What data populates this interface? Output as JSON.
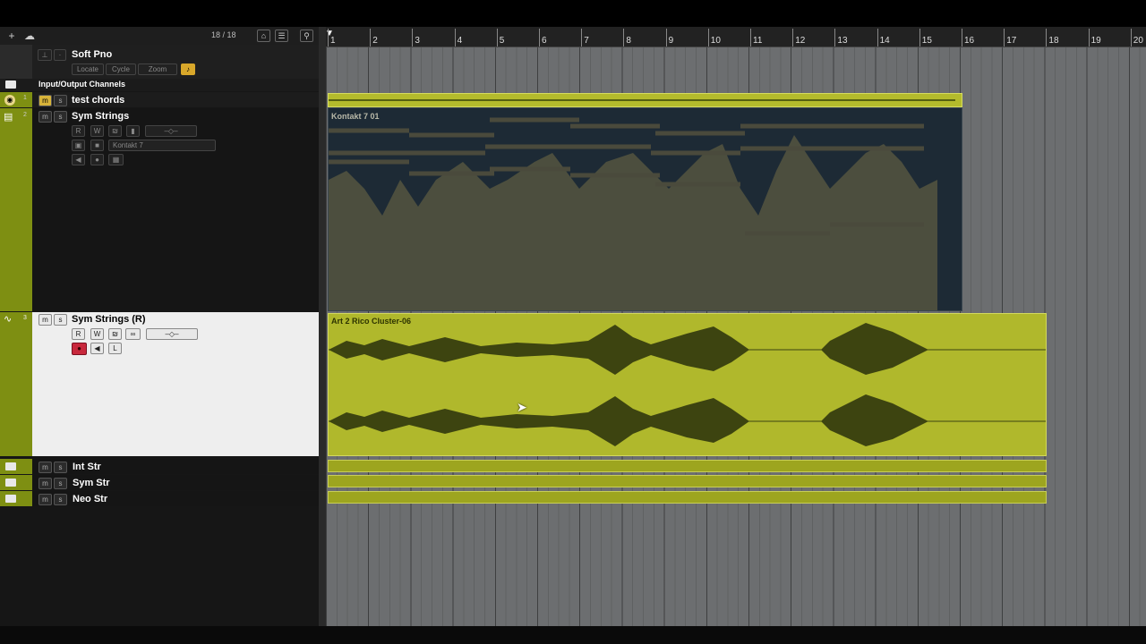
{
  "toolbar": {
    "add_track_icon": "plus-icon",
    "counter": "18 / 18"
  },
  "tracks": {
    "soft_pno": {
      "name": "Soft Pno",
      "buttons": [
        "Locate",
        "Cycle",
        "Zoom"
      ]
    },
    "io_folder": {
      "name": "Input/Output Channels"
    },
    "test_chords": {
      "name": "test chords",
      "number": "1"
    },
    "sym_strings": {
      "name": "Sym Strings",
      "number": "2",
      "instrument": "Kontakt 7"
    },
    "sym_strings_r": {
      "name": "Sym Strings (R)",
      "number": "3"
    },
    "int_str": {
      "name": "Int Str"
    },
    "sym_str": {
      "name": "Sym Str"
    },
    "neo_str": {
      "name": "Neo Str"
    },
    "mute_label": "m",
    "solo_label": "s",
    "read_label": "R",
    "write_label": "W",
    "l_label": "L"
  },
  "ruler": {
    "bars": [
      "1",
      "2",
      "3",
      "4",
      "5",
      "6",
      "7",
      "8",
      "9",
      "10",
      "11",
      "12",
      "13",
      "14",
      "15",
      "16",
      "17",
      "18",
      "19",
      "20"
    ]
  },
  "events": {
    "midi_part": "Kontakt 7 01",
    "audio_part": "Art 2 Rico Cluster-06"
  },
  "colors": {
    "accent": "#8da117",
    "event_yellow": "#b0b82c",
    "midi_bg": "#1d2a35",
    "record_red": "#c8283c"
  }
}
